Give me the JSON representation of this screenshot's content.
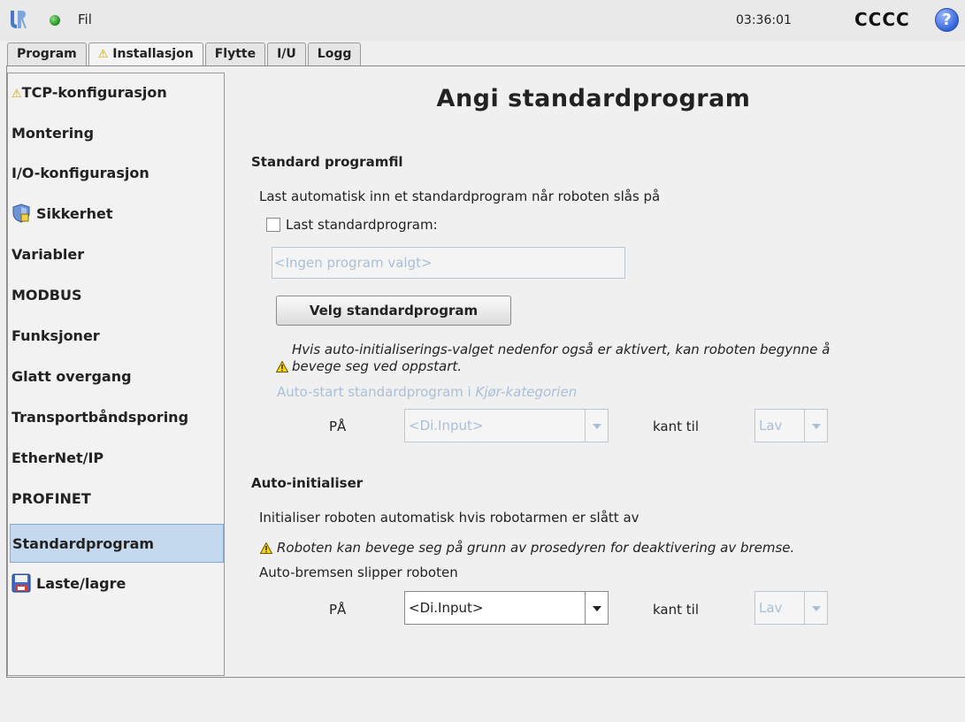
{
  "topbar": {
    "logo_icon": "ur-logo-icon",
    "status_icon": "status-green-dot-icon",
    "file_menu": "Fil",
    "clock": "03:36:01",
    "robot_name": "CCCC",
    "help_icon": "help-question-icon",
    "help_glyph": "?"
  },
  "tabs": [
    {
      "label": "Program",
      "warn": false,
      "active": false
    },
    {
      "label": "Installasjon",
      "warn": true,
      "active": true
    },
    {
      "label": "Flytte",
      "warn": false,
      "active": false
    },
    {
      "label": "I/U",
      "warn": false,
      "active": false
    },
    {
      "label": "Logg",
      "warn": false,
      "active": false
    }
  ],
  "warn_glyph": "⚠",
  "sidebar": {
    "items": [
      {
        "label": "TCP-konfigurasjon",
        "icon": "warning-icon"
      },
      {
        "label": "Montering"
      },
      {
        "label": "I/O-konfigurasjon"
      },
      {
        "label": "Sikkerhet",
        "icon": "safety-shield-icon"
      },
      {
        "label": "Variabler"
      },
      {
        "label": "MODBUS"
      },
      {
        "label": "Funksjoner"
      },
      {
        "label": "Glatt overgang"
      },
      {
        "label": "Transportbåndsporing"
      },
      {
        "label": "EtherNet/IP"
      },
      {
        "label": "PROFINET"
      },
      {
        "label": "Standardprogram",
        "selected": true
      },
      {
        "label": "Laste/lagre",
        "icon": "floppy-disk-icon"
      }
    ]
  },
  "main": {
    "title": "Angi standardprogram",
    "section1": {
      "title": "Standard programfil",
      "description": "Last automatisk inn et standardprogram når roboten slås på",
      "checkbox_label": "Last standardprogram:",
      "checkbox_checked": false,
      "program_placeholder": "<Ingen program valgt>",
      "select_button": "Velg standardprogram",
      "warning_line1": "Hvis auto-initialiserings-valget nedenfor også er aktivert, kan roboten begynne å",
      "warning_line2": "bevege seg ved oppstart.",
      "autostart_label_prefix": "Auto-start standardprogram i ",
      "autostart_label_link": "Kjør-kategorien",
      "on_label": "PÅ",
      "input_value": "<Di.Input>",
      "edge_label": "kant til",
      "edge_value": "Lav"
    },
    "section2": {
      "title": "Auto-initialiser",
      "description": "Initialiser roboten automatisk hvis robotarmen er slått av",
      "warning": "Roboten kan bevege seg på grunn av prosedyren for deaktivering av bremse.",
      "brake_label": "Auto-bremsen slipper roboten",
      "on_label": "PÅ",
      "input_value": "<Di.Input>",
      "edge_label": "kant til",
      "edge_value": "Lav"
    }
  }
}
